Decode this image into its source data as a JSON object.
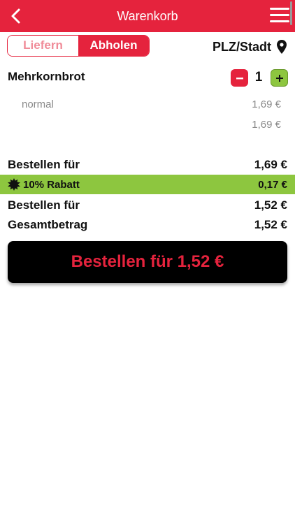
{
  "header": {
    "title": "Warenkorb",
    "back_icon": "chevron-left-icon",
    "menu_icon": "hamburger-menu-icon"
  },
  "mode": {
    "options": [
      "Liefern",
      "Abholen"
    ],
    "selected": "Abholen"
  },
  "location": {
    "label": "PLZ/Stadt",
    "icon": "location-pin-icon"
  },
  "cart": {
    "item": {
      "name": "Mehrkornbrot",
      "quantity": "1",
      "variant": "normal",
      "variant_price": "1,69 €",
      "item_total": "1,69 €"
    }
  },
  "summary": {
    "subtotal_label": "Bestellen für",
    "subtotal_value": "1,69 €",
    "discount_label": "10% Rabatt",
    "discount_value": "0,17 €",
    "after_discount_label": "Bestellen für",
    "after_discount_value": "1,52 €",
    "total_label": "Gesamtbetrag",
    "total_value": "1,52 €"
  },
  "order_button": {
    "label": "Bestellen für 1,52 €"
  },
  "colors": {
    "brand_red": "#e5233d",
    "discount_green": "#8dc63f",
    "button_black": "#000000"
  }
}
